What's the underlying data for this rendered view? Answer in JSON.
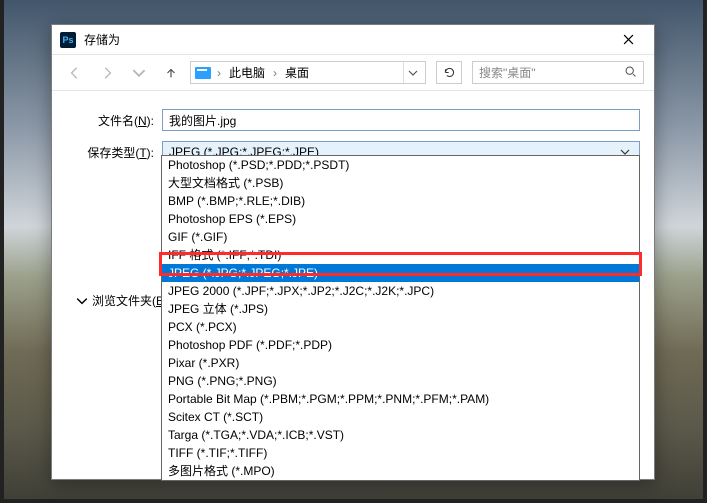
{
  "dialog": {
    "title": "存储为",
    "close_aria": "Close"
  },
  "nav": {
    "crumb1": "此电脑",
    "crumb2": "桌面",
    "search_placeholder": "搜索\"桌面\""
  },
  "form": {
    "filename_label_pre": "文件名(",
    "filename_label_u": "N",
    "filename_label_post": "):",
    "filename_value": "我的图片.jpg",
    "savetype_label_pre": "保存类型(",
    "savetype_label_u": "T",
    "savetype_label_post": "):",
    "savetype_value": "JPEG (*.JPG;*.JPEG;*.JPE)"
  },
  "dropdown": {
    "items": [
      "Photoshop (*.PSD;*.PDD;*.PSDT)",
      "大型文档格式 (*.PSB)",
      "BMP (*.BMP;*.RLE;*.DIB)",
      "Photoshop EPS (*.EPS)",
      "GIF (*.GIF)",
      "IFF 格式 (*.IFF;*.TDI)",
      "JPEG (*.JPG;*.JPEG;*.JPE)",
      "JPEG 2000 (*.JPF;*.JPX;*.JP2;*.J2C;*.J2K;*.JPC)",
      "JPEG 立体 (*.JPS)",
      "PCX (*.PCX)",
      "Photoshop PDF (*.PDF;*.PDP)",
      "Pixar (*.PXR)",
      "PNG (*.PNG;*.PNG)",
      "Portable Bit Map (*.PBM;*.PGM;*.PPM;*.PNM;*.PFM;*.PAM)",
      "Scitex CT (*.SCT)",
      "Targa (*.TGA;*.VDA;*.ICB;*.VST)",
      "TIFF (*.TIF;*.TIFF)",
      "多图片格式 (*.MPO)"
    ],
    "highlighted_index": 6
  },
  "browse": {
    "label_pre": "浏览文件夹(",
    "label_u": "B",
    "label_post": ")"
  }
}
